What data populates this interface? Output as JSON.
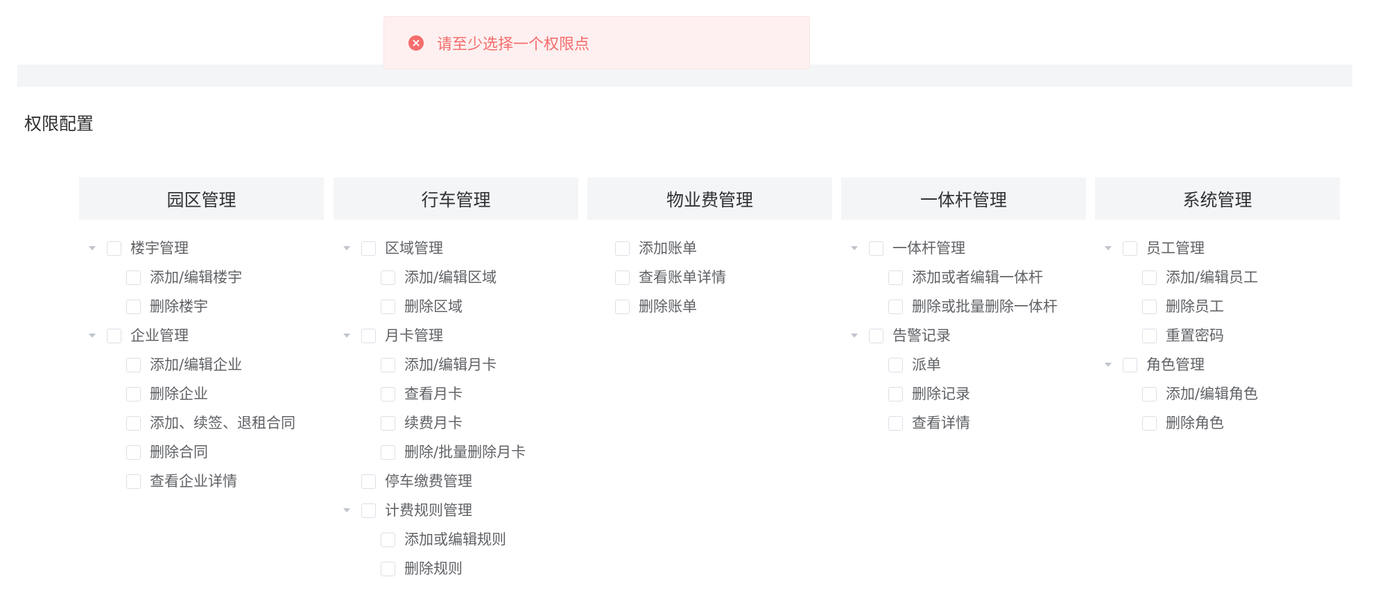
{
  "toast": {
    "message": "请至少选择一个权限点",
    "color": "#f56c6c"
  },
  "section": {
    "title": "权限配置"
  },
  "columns": [
    {
      "title": "园区管理",
      "nodes": [
        {
          "label": "楼宇管理",
          "children": [
            {
              "label": "添加/编辑楼宇"
            },
            {
              "label": "删除楼宇"
            }
          ]
        },
        {
          "label": "企业管理",
          "children": [
            {
              "label": "添加/编辑企业"
            },
            {
              "label": "删除企业"
            },
            {
              "label": "添加、续签、退租合同"
            },
            {
              "label": "删除合同"
            },
            {
              "label": "查看企业详情"
            }
          ]
        }
      ]
    },
    {
      "title": "行车管理",
      "nodes": [
        {
          "label": "区域管理",
          "children": [
            {
              "label": "添加/编辑区域"
            },
            {
              "label": "删除区域"
            }
          ]
        },
        {
          "label": "月卡管理",
          "children": [
            {
              "label": "添加/编辑月卡"
            },
            {
              "label": "查看月卡"
            },
            {
              "label": "续费月卡"
            },
            {
              "label": "删除/批量删除月卡"
            }
          ]
        },
        {
          "label": "停车缴费管理"
        },
        {
          "label": "计费规则管理",
          "children": [
            {
              "label": "添加或编辑规则"
            },
            {
              "label": "删除规则"
            }
          ]
        }
      ]
    },
    {
      "title": "物业费管理",
      "nodes": [
        {
          "label": "添加账单"
        },
        {
          "label": "查看账单详情"
        },
        {
          "label": "删除账单"
        }
      ]
    },
    {
      "title": "一体杆管理",
      "nodes": [
        {
          "label": "一体杆管理",
          "children": [
            {
              "label": "添加或者编辑一体杆"
            },
            {
              "label": "删除或批量删除一体杆"
            }
          ]
        },
        {
          "label": "告警记录",
          "children": [
            {
              "label": "派单"
            },
            {
              "label": "删除记录"
            },
            {
              "label": "查看详情"
            }
          ]
        }
      ]
    },
    {
      "title": "系统管理",
      "nodes": [
        {
          "label": "员工管理",
          "children": [
            {
              "label": "添加/编辑员工"
            },
            {
              "label": "删除员工"
            },
            {
              "label": "重置密码"
            }
          ]
        },
        {
          "label": "角色管理",
          "children": [
            {
              "label": "添加/编辑角色"
            },
            {
              "label": "删除角色"
            }
          ]
        }
      ]
    }
  ]
}
